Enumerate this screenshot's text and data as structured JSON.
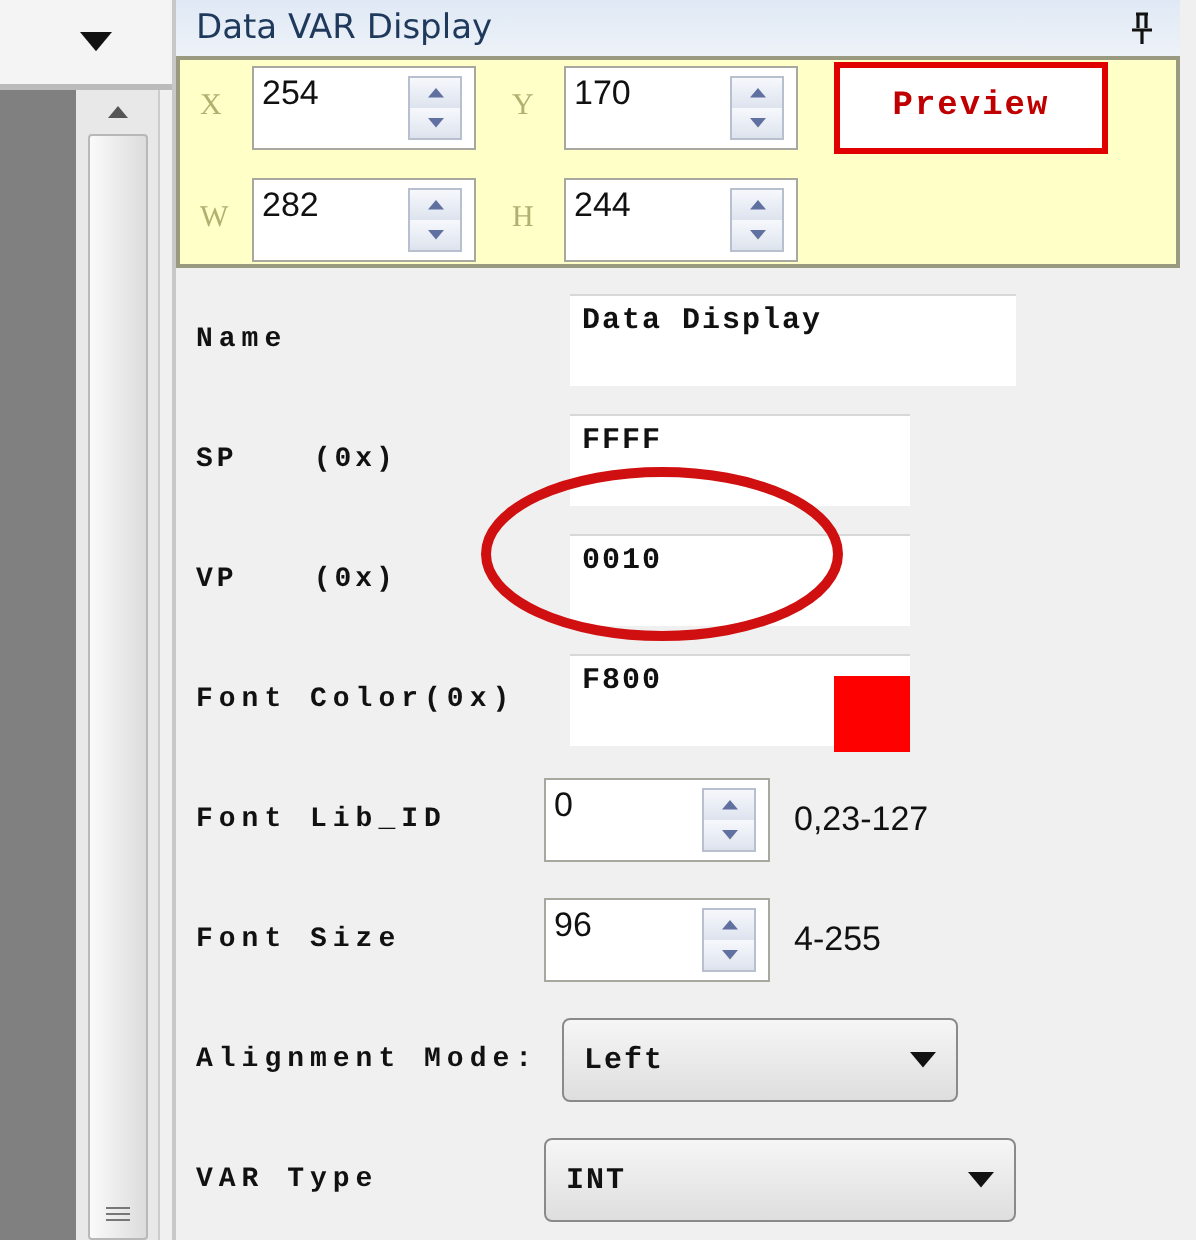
{
  "panel": {
    "title": "Data VAR Display"
  },
  "position": {
    "fields": [
      {
        "axis": "X",
        "value": "254"
      },
      {
        "axis": "Y",
        "value": "170"
      },
      {
        "axis": "W",
        "value": "282"
      },
      {
        "axis": "H",
        "value": "244"
      }
    ],
    "preview_button": "Preview"
  },
  "properties": [
    {
      "kind": "text",
      "label": "Name",
      "value": "Data Display"
    },
    {
      "kind": "text",
      "label": "SP",
      "unit": "(0x)",
      "value": "FFFF"
    },
    {
      "kind": "text",
      "label": "VP",
      "unit": "(0x)",
      "value": "0010",
      "highlighted": true
    },
    {
      "kind": "color",
      "label": "Font Color(0x)",
      "value": "F800",
      "color": "#ff0000"
    },
    {
      "kind": "spin",
      "label": "Font Lib_ID",
      "value": "0",
      "range": "0,23-127"
    },
    {
      "kind": "spin",
      "label": "Font Size",
      "value": "96",
      "range": "4-255"
    },
    {
      "kind": "dropdown",
      "label": "Alignment Mode:",
      "value": "Left"
    },
    {
      "kind": "dropdown",
      "label": "VAR Type",
      "value": "INT"
    }
  ]
}
